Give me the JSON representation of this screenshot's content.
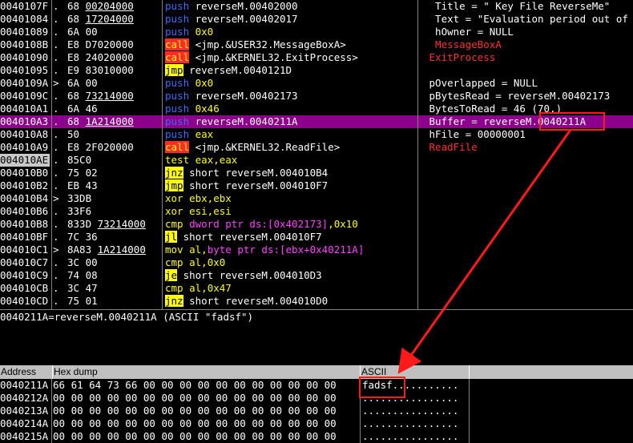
{
  "disasm": {
    "rows": [
      {
        "addr": "0040107F",
        "jmp": ".",
        "hex": "68 00204000",
        "rel": "00204000",
        "asm": [
          {
            "t": "push",
            "c": "mn-push"
          },
          {
            "t": " reverseM.00402000",
            "c": "op-white"
          }
        ],
        "cmt": [
          {
            "t": "  Title = \" Key File ReverseMe\"",
            "c": "op-white"
          }
        ]
      },
      {
        "addr": "00401084",
        "jmp": ".",
        "hex": "68 17204000",
        "rel": "17204000",
        "asm": [
          {
            "t": "push",
            "c": "mn-push"
          },
          {
            "t": " reverseM.00402017",
            "c": "op-white"
          }
        ],
        "cmt": [
          {
            "t": "  Text = \"Evaluation period out of",
            "c": "op-white"
          }
        ]
      },
      {
        "addr": "00401089",
        "jmp": ".",
        "hex": "6A 00",
        "asm": [
          {
            "t": "push",
            "c": "mn-push"
          },
          {
            "t": " 0x0",
            "c": "op-num"
          }
        ],
        "cmt": [
          {
            "t": "  hOwner = NULL",
            "c": "op-white"
          }
        ]
      },
      {
        "addr": "0040108B",
        "jmp": ".",
        "hex": "E8 D7020000",
        "asm": [
          {
            "t": "call",
            "c": "mn-call"
          },
          {
            "t": " <jmp.&USER32.MessageBoxA>",
            "c": "op-white"
          }
        ],
        "cmt": [
          {
            "t": "  MessageBoxA",
            "c": "cmt-red"
          }
        ]
      },
      {
        "addr": "00401090",
        "jmp": ".",
        "hex": "E8 24020000",
        "asm": [
          {
            "t": "call",
            "c": "mn-call"
          },
          {
            "t": " <jmp.&KERNEL32.ExitProcess>",
            "c": "op-white"
          }
        ],
        "cmt": [
          {
            "t": " ExitProcess",
            "c": "cmt-red"
          }
        ]
      },
      {
        "addr": "00401095",
        "jmp": ".",
        "hex": "E9 83010000",
        "asm": [
          {
            "t": "jmp",
            "c": "mn-jmp"
          },
          {
            "t": " reverseM.0040121D",
            "c": "op-white"
          }
        ],
        "cmt": []
      },
      {
        "addr": "0040109A",
        "jmp": ">",
        "hex": "6A 00",
        "asm": [
          {
            "t": "push",
            "c": "mn-push"
          },
          {
            "t": " 0x0",
            "c": "op-num"
          }
        ],
        "cmt": [
          {
            "t": " pOverlapped = NULL",
            "c": "op-white"
          }
        ]
      },
      {
        "addr": "0040109C",
        "jmp": ".",
        "hex": "68 73214000",
        "rel": "73214000",
        "asm": [
          {
            "t": "push",
            "c": "mn-push"
          },
          {
            "t": " reverseM.00402173",
            "c": "op-white"
          }
        ],
        "cmt": [
          {
            "t": " pBytesRead = reverseM.00402173",
            "c": "op-white"
          }
        ]
      },
      {
        "addr": "004010A1",
        "jmp": ".",
        "hex": "6A 46",
        "asm": [
          {
            "t": "push",
            "c": "mn-push"
          },
          {
            "t": " 0x46",
            "c": "op-num"
          }
        ],
        "cmt": [
          {
            "t": " BytesToRead = 46 (70.)",
            "c": "op-white"
          }
        ]
      },
      {
        "addr": "004010A3",
        "jmp": ".",
        "hex": "68 1A214000",
        "rel": "1A214000",
        "sel": true,
        "asm": [
          {
            "t": "push",
            "c": "mn-push"
          },
          {
            "t": " reverseM.0040211A",
            "c": "op-white"
          }
        ],
        "cmt": [
          {
            "t": " Buffer = reverseM.0040211A",
            "c": "op-white"
          }
        ]
      },
      {
        "addr": "004010A8",
        "jmp": ".",
        "hex": "50",
        "asm": [
          {
            "t": "push",
            "c": "mn-push"
          },
          {
            "t": " eax",
            "c": "op-num"
          }
        ],
        "cmt": [
          {
            "t": " hFile = 00000001",
            "c": "op-white"
          }
        ]
      },
      {
        "addr": "004010A9",
        "jmp": ".",
        "hex": "E8 2F020000",
        "asm": [
          {
            "t": "call",
            "c": "mn-call"
          },
          {
            "t": " <jmp.&KERNEL32.ReadFile>",
            "c": "op-white"
          }
        ],
        "cmt": [
          {
            "t": " ReadFile",
            "c": "cmt-red"
          }
        ]
      },
      {
        "addr": "004010AE",
        "jmp": ".",
        "hex": "85C0",
        "addrhl": true,
        "asm": [
          {
            "t": "test",
            "c": "mn-test"
          },
          {
            "t": " eax,eax",
            "c": "op-num"
          }
        ],
        "cmt": []
      },
      {
        "addr": "004010B0",
        "jmp": ".",
        "hex": "75 02",
        "asm": [
          {
            "t": "jnz",
            "c": "mn-jcc"
          },
          {
            "t": " short reverseM.004010B4",
            "c": "op-white"
          }
        ],
        "cmt": []
      },
      {
        "addr": "004010B2",
        "jmp": ".",
        "hex": "EB 43",
        "asm": [
          {
            "t": "jmp",
            "c": "mn-jmp"
          },
          {
            "t": " short reverseM.004010F7",
            "c": "op-white"
          }
        ],
        "cmt": []
      },
      {
        "addr": "004010B4",
        "jmp": ">",
        "hex": "33DB",
        "asm": [
          {
            "t": "xor",
            "c": "mn-xor"
          },
          {
            "t": " ebx,ebx",
            "c": "op-num"
          }
        ],
        "cmt": []
      },
      {
        "addr": "004010B6",
        "jmp": ".",
        "hex": "33F6",
        "asm": [
          {
            "t": "xor",
            "c": "mn-xor"
          },
          {
            "t": " esi,esi",
            "c": "op-num"
          }
        ],
        "cmt": []
      },
      {
        "addr": "004010B8",
        "jmp": ".",
        "hex": "833D 73214000",
        "rel": "73214000",
        "asm": [
          {
            "t": "cmp",
            "c": "mn-cmp"
          },
          {
            "t": " dword ptr ds:[0x402173]",
            "c": "op-mem"
          },
          {
            "t": ",0x10",
            "c": "op-num"
          }
        ],
        "cmt": []
      },
      {
        "addr": "004010BF",
        "jmp": ".",
        "hex": "7C 36",
        "asm": [
          {
            "t": "jl",
            "c": "mn-jcc"
          },
          {
            "t": " short reverseM.004010F7",
            "c": "op-white"
          }
        ],
        "cmt": []
      },
      {
        "addr": "004010C1",
        "jmp": ">",
        "hex": "8A83 1A214000",
        "rel": "1A214000",
        "asm": [
          {
            "t": "mov",
            "c": "mn-mov"
          },
          {
            "t": " al,",
            "c": "op-num"
          },
          {
            "t": "byte ptr ds:[ebx+0x40211A]",
            "c": "op-mem"
          }
        ],
        "cmt": []
      },
      {
        "addr": "004010C7",
        "jmp": ".",
        "hex": "3C 00",
        "asm": [
          {
            "t": "cmp",
            "c": "mn-cmp"
          },
          {
            "t": " al,",
            "c": "op-num"
          },
          {
            "t": "0x0",
            "c": "op-num"
          }
        ],
        "cmt": []
      },
      {
        "addr": "004010C9",
        "jmp": ".",
        "hex": "74 08",
        "asm": [
          {
            "t": "je",
            "c": "mn-jcc"
          },
          {
            "t": " short reverseM.004010D3",
            "c": "op-white"
          }
        ],
        "cmt": []
      },
      {
        "addr": "004010CB",
        "jmp": ".",
        "hex": "3C 47",
        "asm": [
          {
            "t": "cmp",
            "c": "mn-cmp"
          },
          {
            "t": " al,",
            "c": "op-num"
          },
          {
            "t": "0x47",
            "c": "op-num"
          }
        ],
        "cmt": []
      },
      {
        "addr": "004010CD",
        "jmp": ".",
        "hex": "75 01",
        "asm": [
          {
            "t": "jnz",
            "c": "mn-jcc"
          },
          {
            "t": " short reverseM.004010D0",
            "c": "op-white"
          }
        ],
        "cmt": []
      }
    ]
  },
  "info": {
    "text": "0040211A=reverseM.0040211A (ASCII \"fadsf\")"
  },
  "dump": {
    "headers": {
      "address": "Address",
      "hex": "Hex dump",
      "ascii": "ASCII"
    },
    "rows": [
      {
        "addr": "0040211A",
        "hex": "66 61 64 73 66 00 00 00 00 00 00 00 00 00 00 00",
        "ascii": "fadsf..........."
      },
      {
        "addr": "0040212A",
        "hex": "00 00 00 00 00 00 00 00 00 00 00 00 00 00 00 00",
        "ascii": "................"
      },
      {
        "addr": "0040213A",
        "hex": "00 00 00 00 00 00 00 00 00 00 00 00 00 00 00 00",
        "ascii": "................"
      },
      {
        "addr": "0040214A",
        "hex": "00 00 00 00 00 00 00 00 00 00 00 00 00 00 00 00",
        "ascii": "................"
      },
      {
        "addr": "0040215A",
        "hex": "00 00 00 00 00 00 00 00 00 00 00 00 00 00 00 00",
        "ascii": "................"
      }
    ]
  },
  "colors": {
    "selection": "#8c008c",
    "annotation": "#ff1a1a",
    "push": "#3b6cff",
    "call_bg": "#ff2a2a",
    "jump_bg": "#ffff00"
  }
}
